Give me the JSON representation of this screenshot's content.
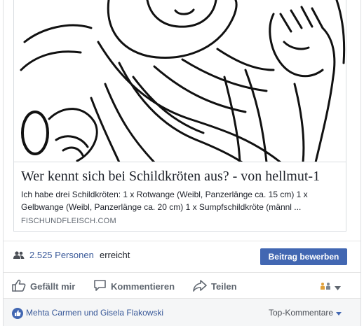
{
  "link_preview": {
    "title": "Wer kennt sich bei Schildkröten aus? - von hellmut-1",
    "description": "Ich habe drei Schildkröten: 1 x Rotwange (Weibl, Panzerlänge ca. 15 cm) 1 x Gelbwange (Weibl, Panzerlänge ca. 20 cm) 1 x Sumpfschildkröte (männl ...",
    "domain": "FISCHUNDFLEISCH.COM",
    "image_icon": "cartoon-illustration"
  },
  "reach": {
    "count": "2.525 Personen",
    "text": "erreicht",
    "boost_label": "Beitrag bewerben",
    "icon": "people-icon"
  },
  "actions": {
    "like_label": "Gefällt mir",
    "comment_label": "Kommentieren",
    "share_label": "Teilen",
    "like_icon": "thumbs-up-icon",
    "comment_icon": "comment-icon",
    "share_icon": "share-icon",
    "audience_icon": "audience-selector-icon"
  },
  "likes": {
    "names": "Mehta Carmen und Gisela Flakowski",
    "sort_label": "Top-Kommentare",
    "icon": "like-badge-icon"
  },
  "colors": {
    "link_blue": "#385898",
    "button_blue": "#4267b2",
    "grey_text": "#606770"
  }
}
